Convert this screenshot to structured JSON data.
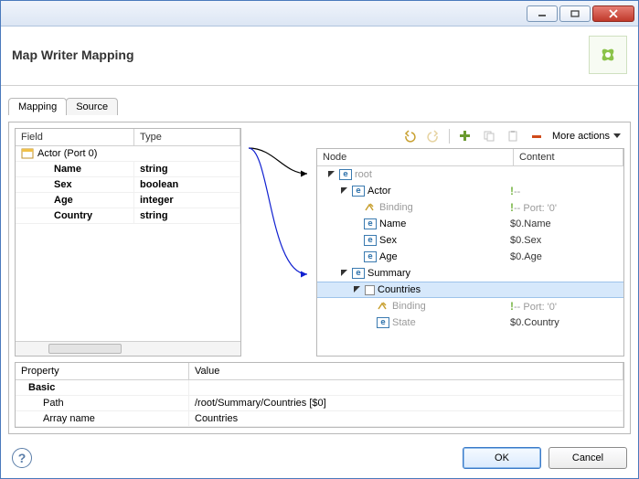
{
  "dialog": {
    "title": "Map Writer Mapping"
  },
  "tabs": {
    "mapping": "Mapping",
    "source": "Source"
  },
  "leftGrid": {
    "headers": {
      "field": "Field",
      "type": "Type"
    },
    "portRow": "Actor (Port 0)",
    "rows": [
      {
        "field": "Name",
        "type": "string"
      },
      {
        "field": "Sex",
        "type": "boolean"
      },
      {
        "field": "Age",
        "type": "integer"
      },
      {
        "field": "Country",
        "type": "string"
      }
    ]
  },
  "toolbar": {
    "moreActions": "More actions"
  },
  "tree": {
    "headers": {
      "node": "Node",
      "content": "Content"
    },
    "nodes": {
      "root": "root",
      "actor": "Actor",
      "binding1": "Binding",
      "binding1content": "Port: '0'",
      "name": "Name",
      "namecontent": "$0.Name",
      "sex": "Sex",
      "sexcontent": "$0.Sex",
      "age": "Age",
      "agecontent": "$0.Age",
      "summary": "Summary",
      "countries": "Countries",
      "binding2": "Binding",
      "binding2content": "Port: '0'",
      "state": "State",
      "statecontent": "$0.Country"
    }
  },
  "props": {
    "headers": {
      "property": "Property",
      "value": "Value"
    },
    "basic": "Basic",
    "path": {
      "label": "Path",
      "value": "/root/Summary/Countries [$0]"
    },
    "arrayname": {
      "label": "Array name",
      "value": "Countries"
    }
  },
  "footer": {
    "ok": "OK",
    "cancel": "Cancel"
  }
}
